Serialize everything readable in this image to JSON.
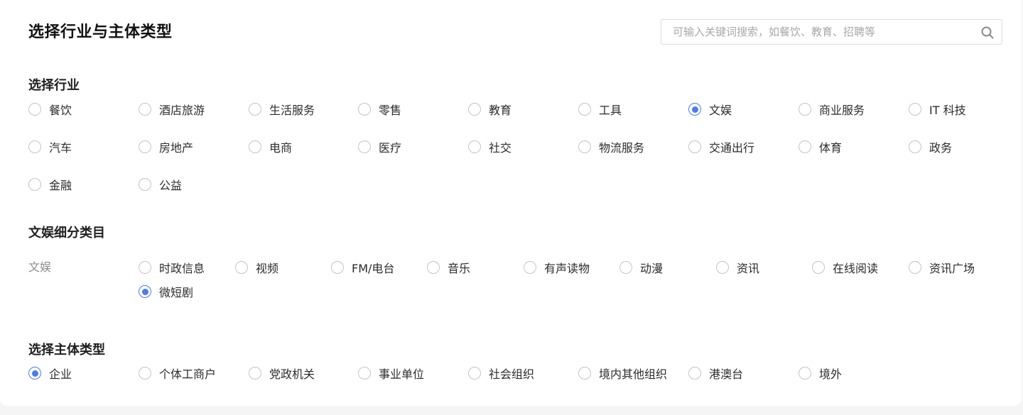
{
  "header": {
    "title": "选择行业与主体类型",
    "search_placeholder": "可输入关键词搜索，如餐饮、教育、招聘等",
    "search_value": ""
  },
  "industry": {
    "title": "选择行业",
    "selected": "文娱",
    "options": [
      {
        "label": "餐饮",
        "checked": false
      },
      {
        "label": "酒店旅游",
        "checked": false
      },
      {
        "label": "生活服务",
        "checked": false
      },
      {
        "label": "零售",
        "checked": false
      },
      {
        "label": "教育",
        "checked": false
      },
      {
        "label": "工具",
        "checked": false
      },
      {
        "label": "文娱",
        "checked": true
      },
      {
        "label": "商业服务",
        "checked": false
      },
      {
        "label": "IT 科技",
        "checked": false
      },
      {
        "label": "汽车",
        "checked": false
      },
      {
        "label": "房地产",
        "checked": false
      },
      {
        "label": "电商",
        "checked": false
      },
      {
        "label": "医疗",
        "checked": false
      },
      {
        "label": "社交",
        "checked": false
      },
      {
        "label": "物流服务",
        "checked": false
      },
      {
        "label": "交通出行",
        "checked": false
      },
      {
        "label": "体育",
        "checked": false
      },
      {
        "label": "政务",
        "checked": false
      },
      {
        "label": "金融",
        "checked": false
      },
      {
        "label": "公益",
        "checked": false
      }
    ]
  },
  "subcategory": {
    "title": "文娱细分类目",
    "row_label": "文娱",
    "selected": "微短剧",
    "options": [
      {
        "label": "时政信息",
        "checked": false
      },
      {
        "label": "视频",
        "checked": false
      },
      {
        "label": "FM/电台",
        "checked": false
      },
      {
        "label": "音乐",
        "checked": false
      },
      {
        "label": "有声读物",
        "checked": false
      },
      {
        "label": "动漫",
        "checked": false
      },
      {
        "label": "资讯",
        "checked": false
      },
      {
        "label": "在线阅读",
        "checked": false
      },
      {
        "label": "资讯广场",
        "checked": false
      },
      {
        "label": "微短剧",
        "checked": true
      }
    ]
  },
  "entity": {
    "title": "选择主体类型",
    "selected": "企业",
    "options": [
      {
        "label": "企业",
        "checked": true
      },
      {
        "label": "个体工商户",
        "checked": false
      },
      {
        "label": "党政机关",
        "checked": false
      },
      {
        "label": "事业单位",
        "checked": false
      },
      {
        "label": "社会组织",
        "checked": false
      },
      {
        "label": "境内其他组织",
        "checked": false
      },
      {
        "label": "港澳台",
        "checked": false
      },
      {
        "label": "境外",
        "checked": false
      }
    ]
  },
  "colors": {
    "accent": "#4a7cf0",
    "radio_border": "#c4c4c4",
    "text_primary": "#1f1f1f",
    "text_secondary": "#8c8c8c",
    "page_bg": "#f5f5f5",
    "card_bg": "#ffffff"
  },
  "icons": {
    "search": "search-icon"
  }
}
